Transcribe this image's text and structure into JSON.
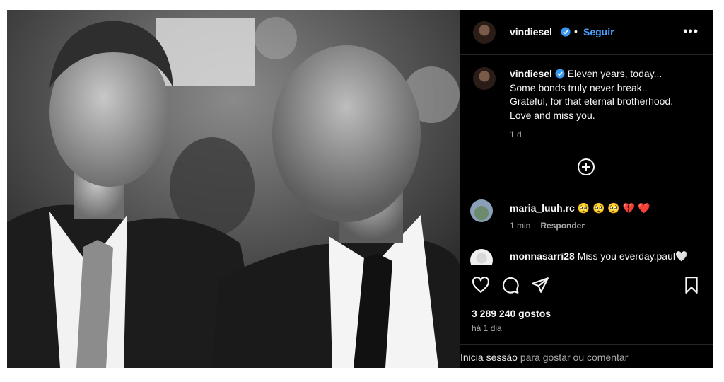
{
  "post": {
    "author": "vindiesel",
    "follow_label": "Seguir",
    "separator": "•",
    "more_label": "•••",
    "caption_lines": [
      "Eleven years, today...",
      "Some bonds truly never break..",
      "Grateful, for that eternal brotherhood.",
      "Love and miss you."
    ],
    "caption_time": "1 d"
  },
  "comments": [
    {
      "user": "maria_luuh.rc",
      "text": "🥺 🥺 🥺 💔 ❤️",
      "time": "1 min",
      "reply_label": "Responder"
    },
    {
      "user": "monnasarri28",
      "text": "Miss you everday,paul🤍"
    }
  ],
  "actions": {
    "likes": "3 289 240 gostos",
    "posted": "há 1 dia"
  },
  "login": {
    "link": "Inicia sessão",
    "rest": "para gostar ou comentar"
  },
  "colors": {
    "accent": "#4aa3ff",
    "verified": "#3897f0",
    "background": "#000000"
  }
}
